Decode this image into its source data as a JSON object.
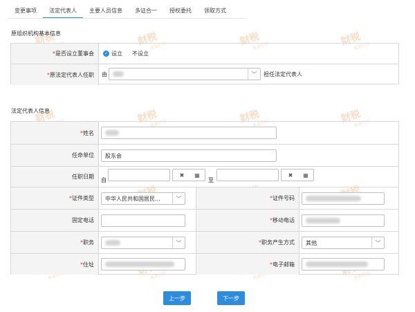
{
  "tabs": [
    "变更事项",
    "法定代表人",
    "主要人员信息",
    "多证合一",
    "授权委托",
    "领取方式"
  ],
  "original_section": {
    "title": "原组织机构基本信息",
    "board_label": "*是否设立董事会",
    "board_opt_yes": "设立",
    "board_opt_no": "不设立",
    "rep_label": "*原法定代表人任职",
    "rep_prefix": "由",
    "rep_suffix": "担任法定代表人"
  },
  "rep_section": {
    "title": "法定代表人信息",
    "name_label": "*姓名",
    "unit_label": "任命单位",
    "unit_value": "股东会",
    "term_label": "任职日期",
    "term_from": "自",
    "term_to": "至",
    "id_type_label": "*证件类型",
    "id_type_value": "中华人民共和国居民...",
    "id_no_label": "*证件号码",
    "landline_label": "固定电话",
    "mobile_label": "*移动电话",
    "position_label": "*职务",
    "position_source_label": "*职务产生方式",
    "position_source_value": "其他",
    "address_label": "*住址",
    "email_label": "*电子邮箱"
  },
  "buttons": {
    "prev": "上一步",
    "next": "下一步"
  },
  "watermark": {
    "text": "财税",
    "sub": "卖会打印"
  },
  "colors": {
    "accent": "#2e8cde",
    "required": "#e4393c"
  }
}
